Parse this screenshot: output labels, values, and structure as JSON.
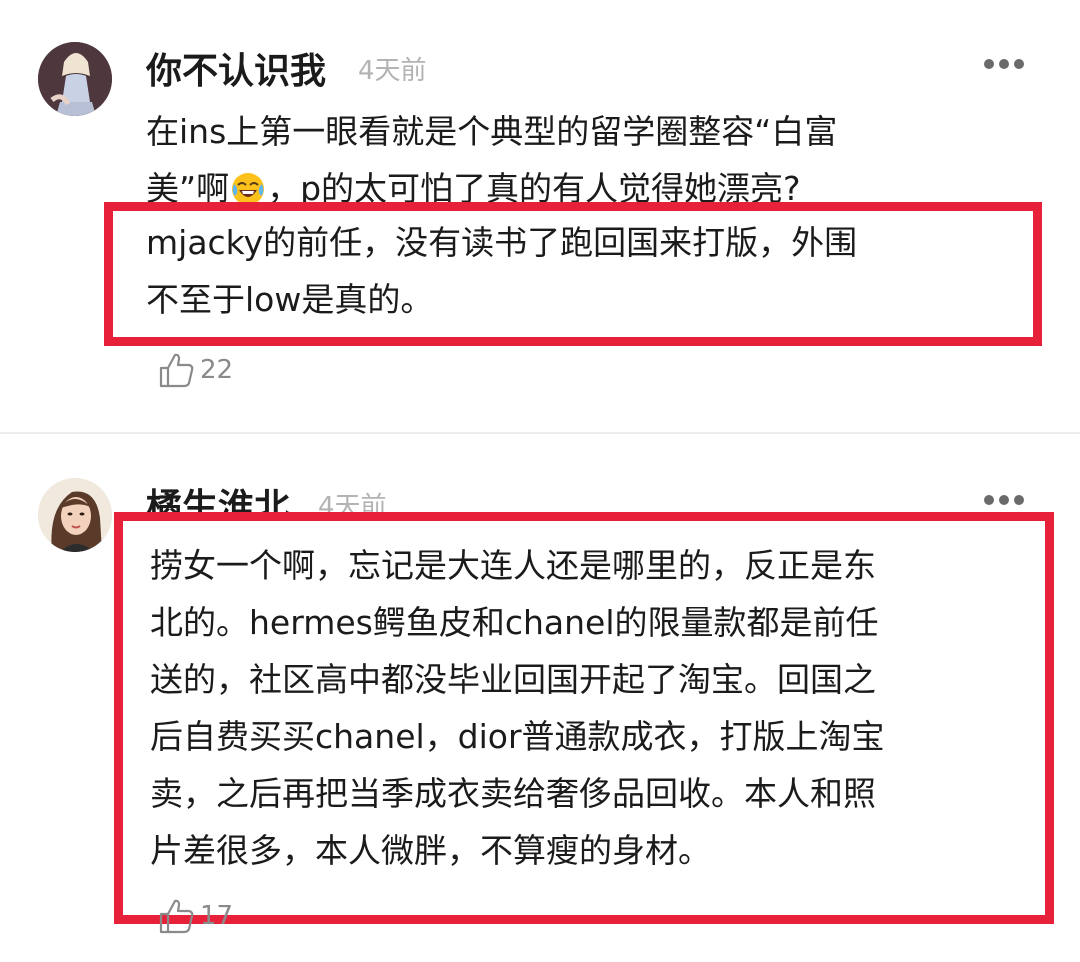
{
  "comments": [
    {
      "username": "你不认识我",
      "time": "4天前",
      "text_lines": [
        "在ins上第一眼看就是个典型的留学圈整容“白富",
        "美”啊",
        "，p的太可怕了真的有人觉得她漂亮?"
      ],
      "highlight_lines": [
        "mjacky的前任，没有读书了跑回国来打版，外围",
        "不至于low是真的。"
      ],
      "likes": "22"
    },
    {
      "username": "橘生淮北",
      "time": "4天前",
      "highlight_lines": [
        "捞女一个啊，忘记是大连人还是哪里的，反正是东",
        "北的。hermes鳄鱼皮和chanel的限量款都是前任",
        "送的，社区高中都没毕业回国开起了淘宝。回国之",
        "后自费买买chanel，dior普通款成衣，打版上淘宝",
        "卖，之后再把当季成衣卖给奢侈品回收。本人和照",
        "片差很多，本人微胖，不算瘦的身材。"
      ],
      "likes": "17"
    }
  ],
  "icons": {
    "more": "more-dots-icon",
    "like": "thumbs-up-icon",
    "emoji": "laughing-tears-emoji"
  },
  "colors": {
    "highlight_border": "#e8213a",
    "time_text": "#b3b3b3",
    "like_text": "#8a8a8a"
  }
}
